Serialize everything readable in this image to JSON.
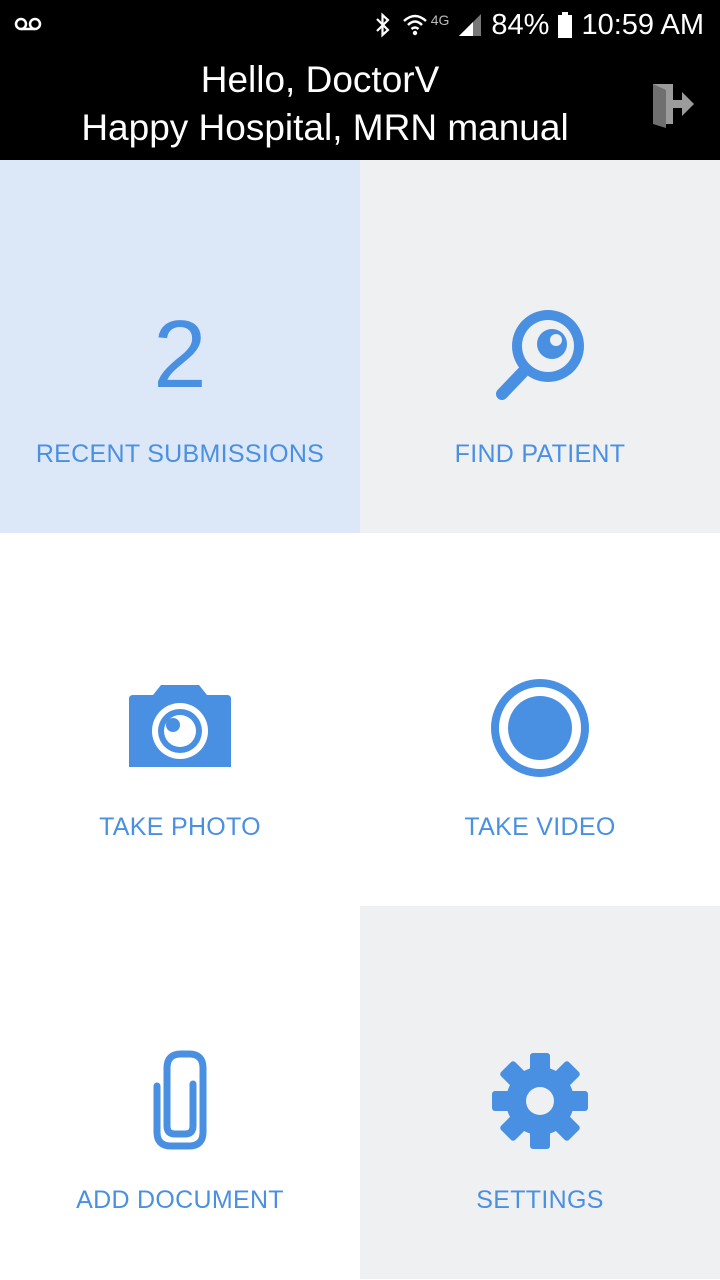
{
  "status_bar": {
    "battery": "84%",
    "time": "10:59 AM",
    "network": "4G",
    "icons": [
      "voicemail-icon",
      "bluetooth-icon",
      "wifi-icon",
      "signal-icon",
      "battery-icon"
    ]
  },
  "header": {
    "greeting": "Hello, DoctorV",
    "hospital": "Happy Hospital, MRN manual",
    "logout_icon": "logout-icon"
  },
  "tiles": [
    {
      "label": "RECENT SUBMISSIONS",
      "value": "2"
    },
    {
      "label": "FIND PATIENT",
      "icon": "search-icon"
    },
    {
      "label": "TAKE PHOTO",
      "icon": "camera-icon"
    },
    {
      "label": "TAKE VIDEO",
      "icon": "record-icon"
    },
    {
      "label": "ADD DOCUMENT",
      "icon": "paperclip-icon"
    },
    {
      "label": "SETTINGS",
      "icon": "gear-icon"
    }
  ],
  "colors": {
    "accent": "#4a90e2",
    "header_bg": "#000000",
    "tile_highlight": "#dce8f8",
    "tile_gray": "#eff0f2",
    "tile_white": "#ffffff"
  }
}
